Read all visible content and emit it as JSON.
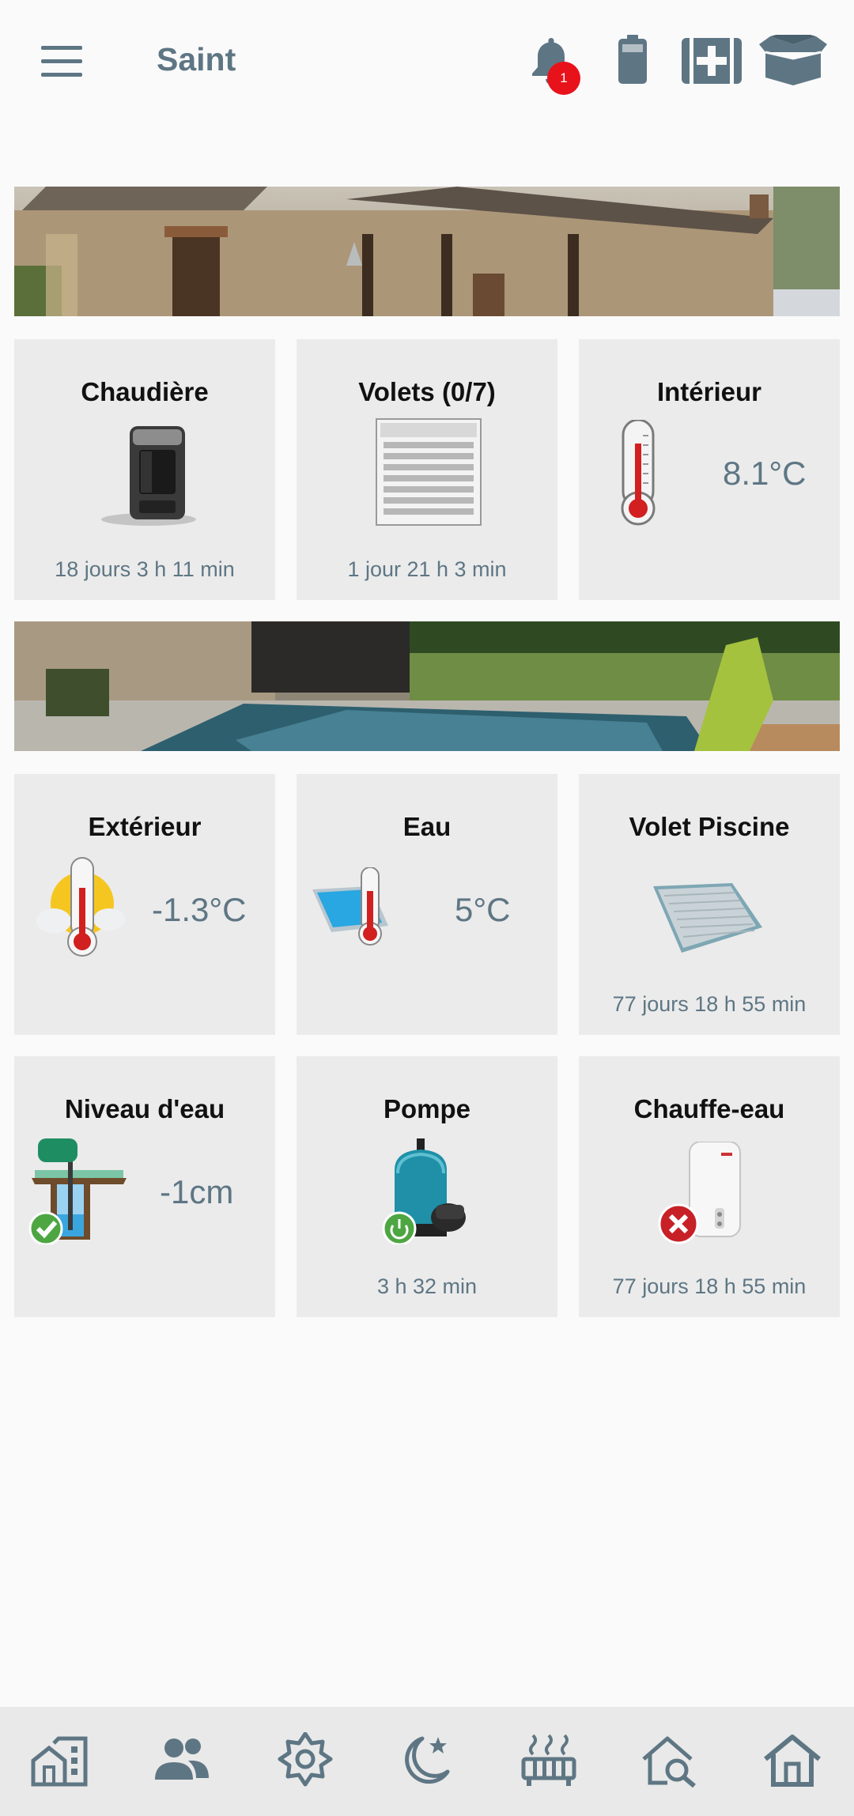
{
  "header": {
    "title": "Saint",
    "notification_count": "1",
    "icons": [
      "menu-icon",
      "bell-icon",
      "battery-icon",
      "medical-kit-icon",
      "open-box-icon"
    ]
  },
  "tiles": [
    {
      "title": "Chaudière",
      "subtitle": "18 jours 3 h 11 min",
      "icon": "stove-icon"
    },
    {
      "title": "Volets (0/7)",
      "subtitle": "1 jour 21 h 3 min",
      "icon": "shutter-icon"
    },
    {
      "title": "Intérieur",
      "value": "8.1°C",
      "icon": "thermometer-icon"
    },
    {
      "title": "Extérieur",
      "value": "-1.3°C",
      "icon": "weather-thermometer-icon"
    },
    {
      "title": "Eau",
      "value": "5°C",
      "icon": "pool-thermometer-icon"
    },
    {
      "title": "Volet Piscine",
      "subtitle": "77 jours 18 h 55 min",
      "icon": "pool-cover-icon"
    },
    {
      "title": "Niveau d'eau",
      "value": "-1cm",
      "icon": "water-well-pump-icon"
    },
    {
      "title": "Pompe",
      "subtitle": "3 h 32 min",
      "icon": "pool-pump-icon"
    },
    {
      "title": "Chauffe-eau",
      "subtitle": "77 jours 18 h 55 min",
      "icon": "water-heater-icon"
    }
  ],
  "bottom_nav": [
    "building-icon",
    "people-icon",
    "brightness-icon",
    "night-icon",
    "heater-icon",
    "house-search-icon",
    "home-icon"
  ],
  "colors": {
    "accent": "#5e7684",
    "tile_bg": "#ebebeb",
    "badge": "#e8121b",
    "nav_bg": "#e9e9e9"
  }
}
